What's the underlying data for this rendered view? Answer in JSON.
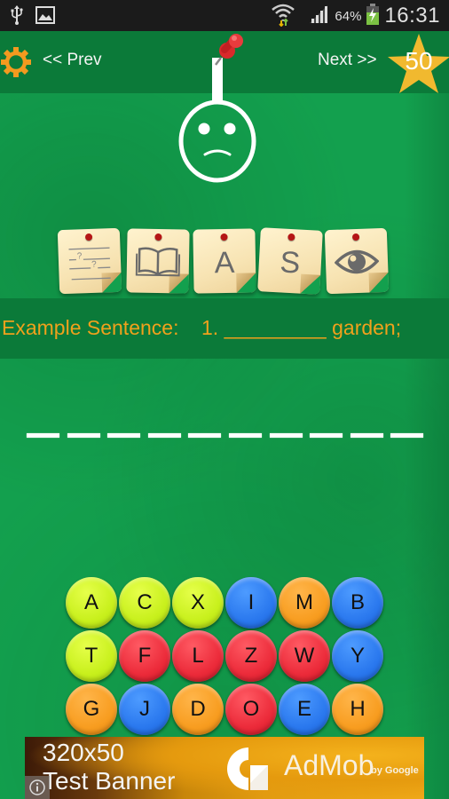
{
  "status_bar": {
    "icons_left": [
      "usb-icon",
      "image-icon"
    ],
    "icons_right": [
      "wifi-icon",
      "signal-icon",
      "battery-charging-icon"
    ],
    "battery_percent": "64%",
    "time": "16:31"
  },
  "header": {
    "settings_icon": "gear-icon",
    "prev_label": "<< Prev",
    "next_label": "Next >>",
    "score": "50",
    "score_icon": "star-icon"
  },
  "hangman": {
    "state": "sad-face",
    "pin_icon": "pushpin-icon"
  },
  "hint_cards": [
    {
      "id": "fill-blank",
      "icon": "fill-blank-lines-icon",
      "glyph": ""
    },
    {
      "id": "definition",
      "icon": "open-book-icon",
      "glyph": ""
    },
    {
      "id": "antonym",
      "icon": "letter-a-icon",
      "glyph": "A"
    },
    {
      "id": "synonym",
      "icon": "letter-s-icon",
      "glyph": "S"
    },
    {
      "id": "reveal",
      "icon": "eye-icon",
      "glyph": ""
    }
  ],
  "example": {
    "label": "Example Sentence:",
    "number": "1.",
    "blank": "_________",
    "rest": "garden;"
  },
  "answer": {
    "length": 10,
    "revealed": [
      "",
      "",
      "",
      "",
      "",
      "",
      "",
      "",
      "",
      ""
    ]
  },
  "keypad": {
    "colors": {
      "lime": "#c8f01c",
      "blue": "#2a78ee",
      "orange": "#f89d20",
      "red": "#ec2b3a"
    },
    "rows": [
      [
        {
          "letter": "A",
          "color": "lime"
        },
        {
          "letter": "C",
          "color": "lime"
        },
        {
          "letter": "X",
          "color": "lime"
        },
        {
          "letter": "I",
          "color": "blue"
        },
        {
          "letter": "M",
          "color": "orange"
        },
        {
          "letter": "B",
          "color": "blue"
        }
      ],
      [
        {
          "letter": "T",
          "color": "lime"
        },
        {
          "letter": "F",
          "color": "red"
        },
        {
          "letter": "L",
          "color": "red"
        },
        {
          "letter": "Z",
          "color": "red"
        },
        {
          "letter": "W",
          "color": "red"
        },
        {
          "letter": "Y",
          "color": "blue"
        }
      ],
      [
        {
          "letter": "G",
          "color": "orange"
        },
        {
          "letter": "J",
          "color": "blue"
        },
        {
          "letter": "D",
          "color": "orange"
        },
        {
          "letter": "O",
          "color": "red"
        },
        {
          "letter": "E",
          "color": "blue"
        },
        {
          "letter": "H",
          "color": "orange"
        }
      ]
    ]
  },
  "ad": {
    "line1": "320x50",
    "line2": "Test Banner",
    "brand": "AdMob",
    "brand_sub": "by Google",
    "info_icon": "info-icon"
  },
  "colors": {
    "background_green": "#13a04e",
    "band_green": "#0b7a39",
    "accent_orange": "#f0a11c",
    "star_gold": "#f1b92f"
  }
}
